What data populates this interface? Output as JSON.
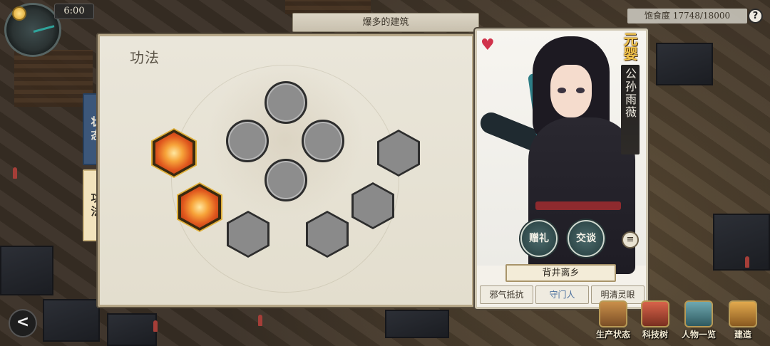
{
  "hud": {
    "time": "6:00",
    "banner_title": "爆多的建筑",
    "satiety": "饱食度 17748/18000",
    "help": "?"
  },
  "panel": {
    "title": "功法",
    "tabs": [
      {
        "label": "状态",
        "active": false
      },
      {
        "label": "功法",
        "active": true
      }
    ]
  },
  "character": {
    "rank": "元婴",
    "name": "公孙雨薇",
    "buttons": {
      "gift": "赠礼",
      "talk": "交谈",
      "menu": "≡"
    },
    "origin": "背井离乡",
    "traits": [
      "邪气抵抗",
      "守门人",
      "明清灵眼"
    ],
    "selected_trait_color": "#4a6f9e"
  },
  "nav": {
    "back": "<",
    "items": [
      {
        "label": "生产状态",
        "icon": "ledger-icon"
      },
      {
        "label": "科技树",
        "icon": "scroll-icon"
      },
      {
        "label": "人物一览",
        "icon": "people-icon"
      },
      {
        "label": "建造",
        "icon": "hammer-icon"
      }
    ]
  },
  "colors": {
    "panel_bg": "#e6e1d3",
    "tab_status": "#3c577a",
    "tab_gongfa": "#f2e3bd",
    "rank_gold": "#f0c24a"
  }
}
